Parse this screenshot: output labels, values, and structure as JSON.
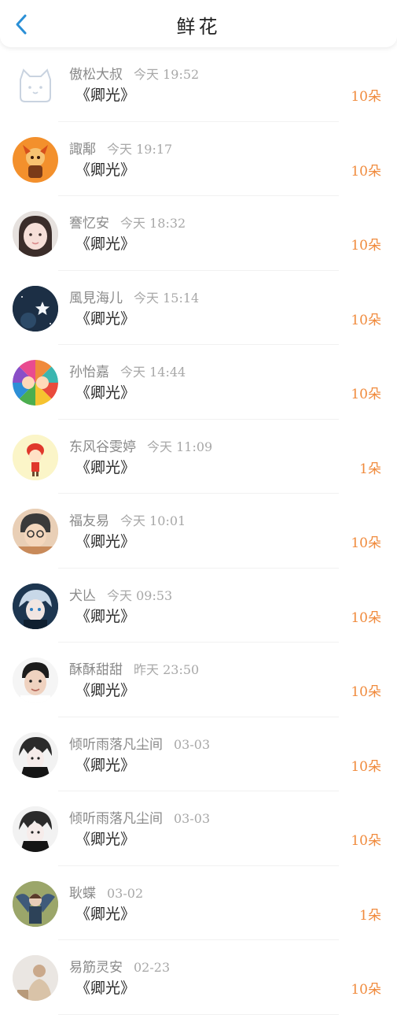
{
  "header": {
    "title": "鲜花"
  },
  "colors": {
    "accent": "#2a8fd6",
    "count": "#f08a3c"
  },
  "gifts": [
    {
      "name": "傲松大叔",
      "time": "今天 19:52",
      "item": "《卿光》",
      "count": "10朵",
      "avatar": "cat-placeholder"
    },
    {
      "name": "諏鄅",
      "time": "今天 19:17",
      "item": "《卿光》",
      "count": "10朵",
      "avatar": "orange-character"
    },
    {
      "name": "謇忆安",
      "time": "今天 18:32",
      "item": "《卿光》",
      "count": "10朵",
      "avatar": "girl-photo"
    },
    {
      "name": "風見海儿",
      "time": "今天 15:14",
      "item": "《卿光》",
      "count": "10朵",
      "avatar": "night-star"
    },
    {
      "name": "孙怡嘉",
      "time": "今天 14:44",
      "item": "《卿光》",
      "count": "10朵",
      "avatar": "cartoon-rainbow"
    },
    {
      "name": "东风谷雯婷",
      "time": "今天 11:09",
      "item": "《卿光》",
      "count": "1朵",
      "avatar": "red-hat-girl"
    },
    {
      "name": "福友易",
      "time": "今天 10:01",
      "item": "《卿光》",
      "count": "10朵",
      "avatar": "glasses-boy"
    },
    {
      "name": "犬亾",
      "time": "今天 09:53",
      "item": "《卿光》",
      "count": "10朵",
      "avatar": "anime-blue"
    },
    {
      "name": "酥酥甜甜",
      "time": "昨天 23:50",
      "item": "《卿光》",
      "count": "10朵",
      "avatar": "man-photo"
    },
    {
      "name": "倾听雨落凡尘间",
      "time": "03-03",
      "item": "《卿光》",
      "count": "10朵",
      "avatar": "anime-dark"
    },
    {
      "name": "倾听雨落凡尘间",
      "time": "03-03",
      "item": "《卿光》",
      "count": "10朵",
      "avatar": "anime-dark"
    },
    {
      "name": "耿蝶",
      "time": "03-02",
      "item": "《卿光》",
      "count": "1朵",
      "avatar": "cosplay-wings"
    },
    {
      "name": "易筋灵安",
      "time": "02-23",
      "item": "《卿光》",
      "count": "10朵",
      "avatar": "person-light"
    }
  ]
}
